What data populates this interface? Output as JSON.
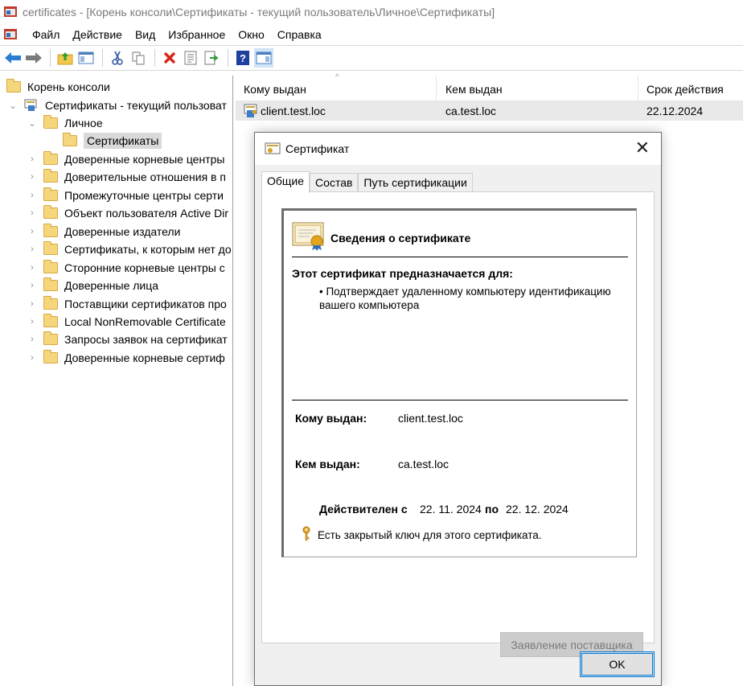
{
  "window": {
    "title": "certificates - [Корень консоли\\Сертификаты - текущий пользователь\\Личное\\Сертификаты]"
  },
  "menu": {
    "items": [
      "Файл",
      "Действие",
      "Вид",
      "Избранное",
      "Окно",
      "Справка"
    ]
  },
  "toolbar": {
    "icons": [
      "back-arrow-icon",
      "forward-arrow-icon",
      "up-folder-icon",
      "show-hide-tree-icon",
      "cut-icon",
      "copy-icon",
      "delete-icon",
      "properties-icon",
      "export-list-icon",
      "help-icon",
      "action-pane-icon"
    ]
  },
  "tree": {
    "root": "Корень консоли",
    "store": "Сертификаты - текущий пользоват",
    "personal": "Личное",
    "certificates": "Сертификаты",
    "items": [
      "Доверенные корневые центры",
      "Доверительные отношения в п",
      "Промежуточные центры серти",
      "Объект пользователя Active Dir",
      "Доверенные издатели",
      "Сертификаты, к которым нет до",
      "Сторонние корневые центры с",
      "Доверенные лица",
      "Поставщики сертификатов про",
      "Local NonRemovable Certificate",
      "Запросы заявок на сертификат",
      "Доверенные корневые сертиф"
    ]
  },
  "list": {
    "columns": [
      "Кому выдан",
      "Кем выдан",
      "Срок действия"
    ],
    "rows": [
      {
        "issued_to": "client.test.loc",
        "issued_by": "ca.test.loc",
        "expires": "22.12.2024"
      }
    ]
  },
  "dialog": {
    "title": "Сертификат",
    "tabs": [
      "Общие",
      "Состав",
      "Путь сертификации"
    ],
    "heading": "Сведения о сертификате",
    "purpose_title": "Этот сертификат предназначается для:",
    "purpose_item": "• Подтверждает удаленному компьютеру идентификацию вашего компьютера",
    "issued_to_label": "Кому выдан:",
    "issued_to_value": "client.test.loc",
    "issued_by_label": "Кем выдан:",
    "issued_by_value": "ca.test.loc",
    "valid_from_label": "Действителен с",
    "valid_from": "22. 11. 2024",
    "valid_to_label": "по",
    "valid_to": "22. 12. 2024",
    "private_key_note": "Есть закрытый ключ для этого сертификата.",
    "issuer_statement_button": "Заявление поставщика",
    "ok_button": "OK"
  },
  "colors": {
    "selection": "#d9d9d9",
    "accent": "#0078d7",
    "folder": "#f6d67c"
  }
}
